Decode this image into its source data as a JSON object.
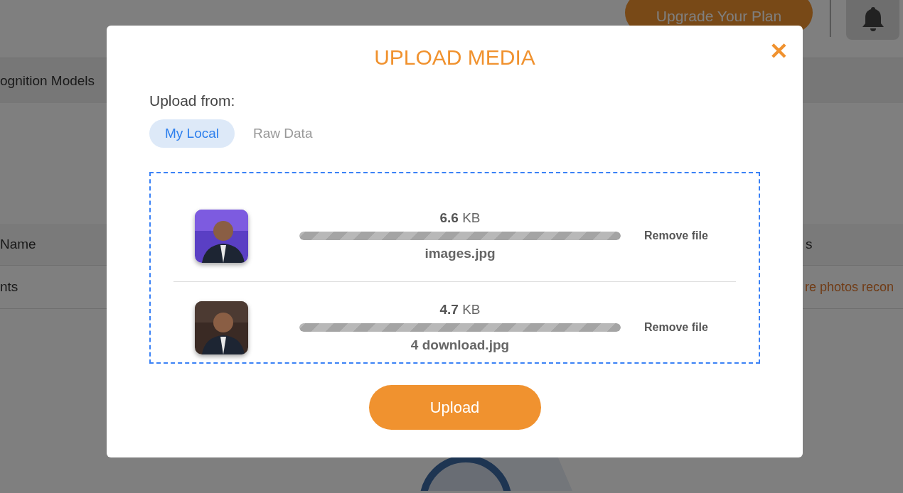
{
  "header": {
    "upgrade_button": "Upgrade Your Plan"
  },
  "nav": {
    "label": "ognition Models"
  },
  "table": {
    "columns": [
      "Name",
      "s"
    ],
    "rows": [
      {
        "cells": [
          "nts",
          "re photos recon"
        ]
      }
    ]
  },
  "dialog": {
    "title": "UPLOAD MEDIA",
    "close": "✕",
    "source_label": "Upload from:",
    "tabs": [
      {
        "label": "My Local",
        "selected": true
      },
      {
        "label": "Raw Data",
        "selected": false
      }
    ],
    "files": [
      {
        "size": "**6.6** KB",
        "level": 1,
        "name": "images.jpg",
        "action": "Remove file"
      },
      {
        "size": "**4.7** KB",
        "level": 1,
        "name": "4 download.jpg",
        "action": "Remove file"
      }
    ],
    "upload_button": "Upload"
  }
}
